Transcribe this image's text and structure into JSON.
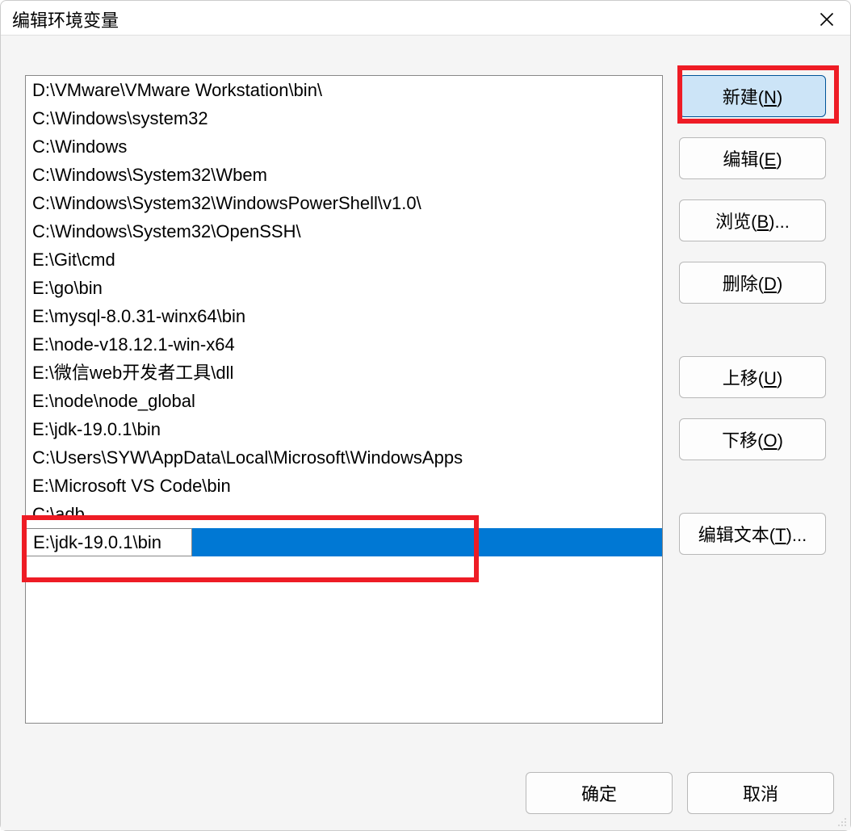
{
  "window": {
    "title": "编辑环境变量"
  },
  "list": {
    "items": [
      "D:\\VMware\\VMware Workstation\\bin\\",
      "C:\\Windows\\system32",
      "C:\\Windows",
      "C:\\Windows\\System32\\Wbem",
      "C:\\Windows\\System32\\WindowsPowerShell\\v1.0\\",
      "C:\\Windows\\System32\\OpenSSH\\",
      "E:\\Git\\cmd",
      "E:\\go\\bin",
      "E:\\mysql-8.0.31-winx64\\bin",
      "E:\\node-v18.12.1-win-x64",
      "E:\\微信web开发者工具\\dll",
      "E:\\node\\node_global",
      "E:\\jdk-19.0.1\\bin",
      "C:\\Users\\SYW\\AppData\\Local\\Microsoft\\WindowsApps",
      "E:\\Microsoft VS Code\\bin",
      "C:\\adb"
    ],
    "editing_value": "E:\\jdk-19.0.1\\bin"
  },
  "buttons": {
    "new_pre": "新建(",
    "new_accel": "N",
    "new_post": ")",
    "edit_pre": "编辑(",
    "edit_accel": "E",
    "edit_post": ")",
    "browse_pre": "浏览(",
    "browse_accel": "B",
    "browse_post": ")...",
    "delete_pre": "删除(",
    "delete_accel": "D",
    "delete_post": ")",
    "moveup_pre": "上移(",
    "moveup_accel": "U",
    "moveup_post": ")",
    "movedown_pre": "下移(",
    "movedown_accel": "O",
    "movedown_post": ")",
    "edittext_pre": "编辑文本(",
    "edittext_accel": "T",
    "edittext_post": ")...",
    "ok": "确定",
    "cancel": "取消"
  }
}
